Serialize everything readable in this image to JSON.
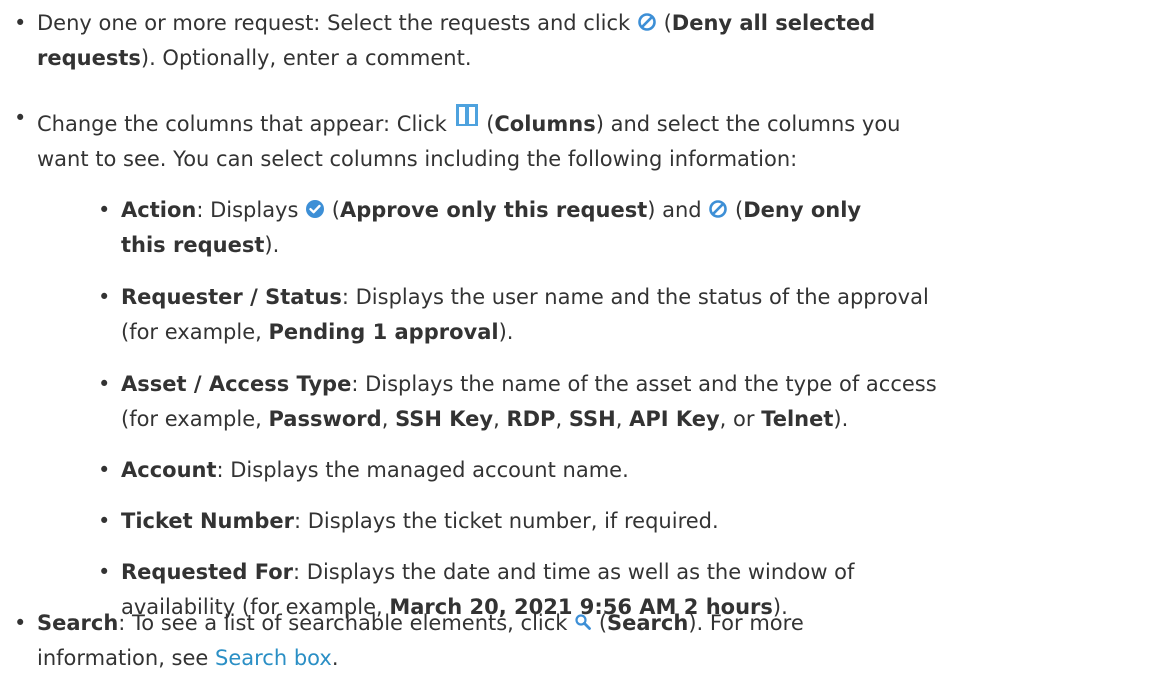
{
  "colors": {
    "text": "#333333",
    "link": "#2b8fc5",
    "approve_icon": "#3d8fd6",
    "deny_icon": "#3d8fd6",
    "columns_icon": "#4ea2de"
  },
  "icons": {
    "deny": "deny-circle-slash-icon",
    "approve": "approve-checkmark-icon",
    "columns": "columns-icon",
    "search": "magnifier-icon"
  },
  "deny": {
    "pre": "Deny one or more request: Select the requests and click ",
    "open": " (",
    "label": "Deny all selected",
    "label2": "requests",
    "post": "). Optionally, enter a comment."
  },
  "columns": {
    "pre": "Change the columns that appear: Click ",
    "open": " (",
    "label": "Columns",
    "post1": ") and select the columns you",
    "post2": "want to see. You can select columns including the following information:"
  },
  "action": {
    "term": "Action",
    "pre": ": Displays ",
    "open1": " (",
    "approve_label": "Approve only this request",
    "mid": ") and ",
    "open2": " (",
    "deny_label": "Deny only",
    "deny_label2": "this request",
    "post": ")."
  },
  "requester": {
    "term": "Requester / Status",
    "line1": ": Displays the user name and the status of the approval",
    "pre2": "(for example, ",
    "example": "Pending 1 approval",
    "post": ")."
  },
  "asset": {
    "term": "Asset / Access Type",
    "line1": ": Displays the name of the asset and the type of access",
    "pre2": "(for example, ",
    "ex1": "Password",
    "sep1": ", ",
    "ex2": "SSH Key",
    "sep2": ", ",
    "ex3": "RDP",
    "sep3": ", ",
    "ex4": "SSH",
    "sep4": ", ",
    "ex5": "API Key",
    "sep5": ", or ",
    "ex6": "Telnet",
    "post": ")."
  },
  "account": {
    "term": "Account",
    "text": ": Displays the managed account name."
  },
  "ticket": {
    "term": "Ticket Number",
    "text": ": Displays the ticket number, if required."
  },
  "requested": {
    "term": "Requested For",
    "line1": ": Displays the date and time as well as the window of",
    "pre2": "availability (for example, ",
    "example": "March 20, 2021 9:56 AM 2 hours",
    "post": ")."
  },
  "search": {
    "term": "Search",
    "pre": ": To see a list of searchable elements, click ",
    "open": " (",
    "label": "Search",
    "post": "). For more",
    "pre2": "information, see ",
    "link": "Search box",
    "end": "."
  }
}
